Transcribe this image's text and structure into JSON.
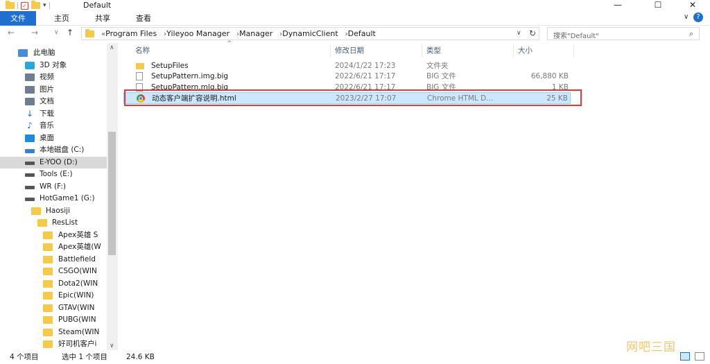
{
  "window": {
    "title": "Default"
  },
  "ribbon": {
    "tabs": [
      "文件",
      "主页",
      "共享",
      "查看"
    ],
    "help": "?"
  },
  "nav": {
    "back": "←",
    "forward": "→",
    "recent": "∨",
    "up": "↑",
    "refresh": "↻",
    "dropdown": "∨",
    "overflow": "«"
  },
  "breadcrumb": [
    "Program Files",
    "Yileyoo Manager",
    "Manager",
    "DynamicClient",
    "Default"
  ],
  "search": {
    "placeholder": "搜索\"Default\""
  },
  "sidebar": {
    "items": [
      "此电脑",
      "3D 对象",
      "视频",
      "图片",
      "文档",
      "下载",
      "音乐",
      "桌面",
      "本地磁盘 (C:)",
      "E-YOO (D:)",
      "Tools (E:)",
      "WR (F:)",
      "HotGame1 (G:)",
      "Haosiji",
      "ResList",
      "Apex英雄 S",
      "Apex英雄(W",
      "Battlefield",
      "CSGO(WIN",
      "Dota2(WIN",
      "Epic(WIN)",
      "GTAV(WIN",
      "PUBG(WIN",
      "Steam(WIN",
      "好司机客户i"
    ]
  },
  "columns": {
    "name": "名称",
    "date": "修改日期",
    "type": "类型",
    "size": "大小"
  },
  "files": [
    {
      "name": "SetupFiles",
      "date": "2024/1/22 17:23",
      "type": "文件夹",
      "size": ""
    },
    {
      "name": "SetupPattern.img.big",
      "date": "2022/6/21 17:17",
      "type": "BIG 文件",
      "size": "66,880 KB"
    },
    {
      "name": "SetupPattern.mlg.big",
      "date": "2022/6/21 17:17",
      "type": "BIG 文件",
      "size": "1 KB"
    },
    {
      "name": "动态客户端扩容说明.html",
      "date": "2023/2/27 17:07",
      "type": "Chrome HTML D...",
      "size": "25 KB"
    }
  ],
  "status": {
    "count": "4 个项目",
    "selected": "选中 1 个项目",
    "selected_size": "24.6 KB"
  },
  "watermark": "网吧三国",
  "colors": {
    "accent": "#1e6fd0",
    "selection": "#cce8ff",
    "highlight_border": "#e53935",
    "folder": "#f7c948"
  }
}
